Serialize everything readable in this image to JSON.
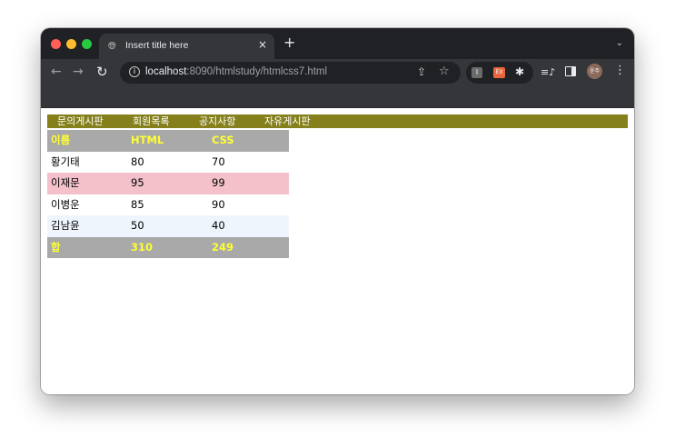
{
  "browser": {
    "tab": {
      "title": "Insert title here",
      "close": "×",
      "icon": "globe-icon"
    },
    "new_tab": "+",
    "tab_menu": "⌄",
    "url": {
      "host": "localhost",
      "rest": ":8090/htmlstudy/htmlcss7.html"
    },
    "extensions": [
      "I",
      "EX"
    ],
    "avatar_text": "윤주"
  },
  "page": {
    "menu": [
      "문의게시판",
      "회원목록",
      "공지사항",
      "자유게시판"
    ],
    "table": {
      "header": [
        "이름",
        "HTML",
        "CSS"
      ],
      "rows": [
        [
          "황기태",
          "80",
          "70"
        ],
        [
          "이재문",
          "95",
          "99"
        ],
        [
          "이병운",
          "85",
          "90"
        ],
        [
          "김남윤",
          "50",
          "40"
        ]
      ],
      "footer": [
        "합",
        "310",
        "249"
      ]
    }
  },
  "colors": {
    "menu_bg": "#85801c",
    "header_bg": "#a9a9a9",
    "header_text": "#ffff33",
    "row_pink": "#f4c1cb",
    "row_blue": "#eff5fc"
  }
}
